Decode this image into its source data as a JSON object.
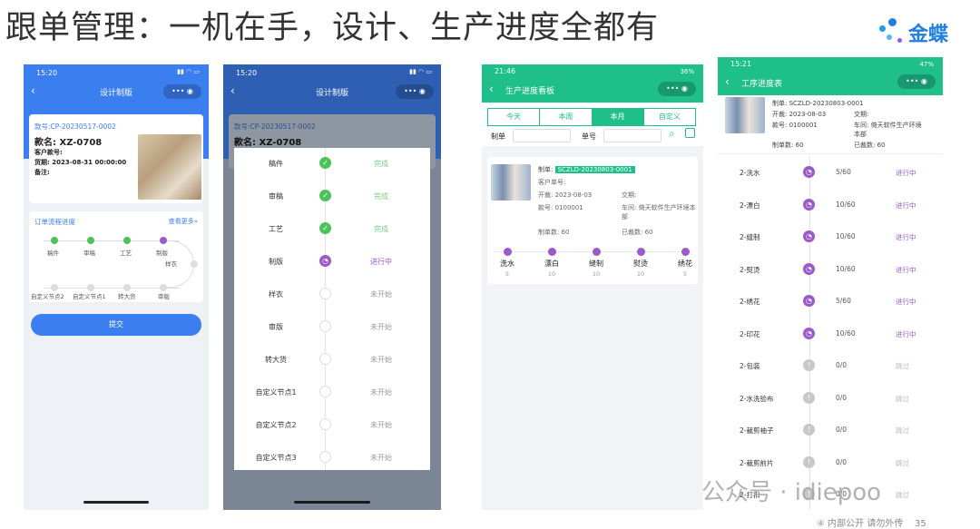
{
  "slide": {
    "title": "跟单管理：一机在手，设计、生产进度全都有",
    "logo": "金蝶",
    "footer": "④ 内部公开 请勿外传",
    "page": "35",
    "watermark": "公众号 · idiepoo"
  },
  "p1": {
    "time": "15:20",
    "title": "设计制版",
    "menu": "•••",
    "order_no": "款号:CP-20230517-0002",
    "style": "款名: XZ-0708",
    "customer": "客户款号:",
    "delivery": "货期: 2023-08-31 00:00:00",
    "remark": "备注:",
    "progress_title": "订单流程进度",
    "more": "查看更多»",
    "row1": [
      "稿件",
      "审稿",
      "工艺",
      "制版"
    ],
    "row1b": "样衣",
    "row2": [
      "自定义节点2",
      "自定义节点1",
      "转大货",
      "审版"
    ],
    "submit": "提交"
  },
  "p2": {
    "time": "15:20",
    "title": "设计制版",
    "order_no": "款号:CP-20230517-0002",
    "style": "款名: XZ-0708",
    "rows": [
      {
        "n": "稿件",
        "s": "完成",
        "st": "done"
      },
      {
        "n": "审稿",
        "s": "完成",
        "st": "done"
      },
      {
        "n": "工艺",
        "s": "完成",
        "st": "done"
      },
      {
        "n": "制版",
        "s": "进行中",
        "st": "doing"
      },
      {
        "n": "样衣",
        "s": "未开始",
        "st": "todo"
      },
      {
        "n": "审版",
        "s": "未开始",
        "st": "todo"
      },
      {
        "n": "转大货",
        "s": "未开始",
        "st": "todo"
      },
      {
        "n": "自定义节点1",
        "s": "未开始",
        "st": "todo"
      },
      {
        "n": "自定义节点2",
        "s": "未开始",
        "st": "todo"
      },
      {
        "n": "自定义节点3",
        "s": "未开始",
        "st": "todo"
      }
    ]
  },
  "p3": {
    "time": "21:46",
    "battery": "36%",
    "title": "生产进度看板",
    "tabs": [
      "今天",
      "本周",
      "本月",
      "自定义"
    ],
    "f1": "制单",
    "f2": "单号",
    "order_lbl": "制单:",
    "order": "SCZLD-20230803-0001",
    "cust": "客户单号:",
    "open": "开裁:  2023-08-03",
    "deliv": "交期:",
    "sku": "款号:  0100001",
    "shop": "车间:  倚天软件生产环境本部",
    "qty": "制单数:  60",
    "cut": "已裁数:  60",
    "steps": [
      {
        "t": "洗水",
        "v": "5"
      },
      {
        "t": "漂白",
        "v": "10"
      },
      {
        "t": "缝制",
        "v": "10"
      },
      {
        "t": "熨烫",
        "v": "10"
      },
      {
        "t": "绣花",
        "v": "5"
      }
    ]
  },
  "p4": {
    "time": "15:21",
    "battery": "47%",
    "title": "工序进度表",
    "order": "制单:  SCZLD-20230803-0001",
    "open": "开裁:  2023-08-03",
    "deliv": "交期:",
    "sku": "款号:  0100001",
    "shop": "车间:  倚天软件生产环境本部",
    "qty": "制单数:  60",
    "cut": "已裁数:  60",
    "rows": [
      {
        "n": "2-洗水",
        "q": "5/60",
        "s": "进行中",
        "st": "doing"
      },
      {
        "n": "2-漂白",
        "q": "10/60",
        "s": "进行中",
        "st": "doing"
      },
      {
        "n": "2-缝制",
        "q": "10/60",
        "s": "进行中",
        "st": "doing"
      },
      {
        "n": "2-熨烫",
        "q": "10/60",
        "s": "进行中",
        "st": "doing"
      },
      {
        "n": "2-绣花",
        "q": "5/60",
        "s": "进行中",
        "st": "doing"
      },
      {
        "n": "2-印花",
        "q": "10/60",
        "s": "进行中",
        "st": "doing"
      },
      {
        "n": "2-包装",
        "q": "0/0",
        "s": "跳过",
        "st": "skip"
      },
      {
        "n": "2-水洗验布",
        "q": "0/0",
        "s": "跳过",
        "st": "skip"
      },
      {
        "n": "2-裁剪袖子",
        "q": "0/0",
        "s": "跳过",
        "st": "skip"
      },
      {
        "n": "2-裁剪前片",
        "q": "0/0",
        "s": "跳过",
        "st": "skip"
      },
      {
        "n": "2-打扣",
        "q": "0/0",
        "s": "跳过",
        "st": "skip"
      }
    ]
  },
  "colors": {
    "blue": "#3b7ef0",
    "green": "#1fbf8a",
    "done": "#4cc35a",
    "doing": "#9b59c9",
    "todo": "#dddddd"
  }
}
